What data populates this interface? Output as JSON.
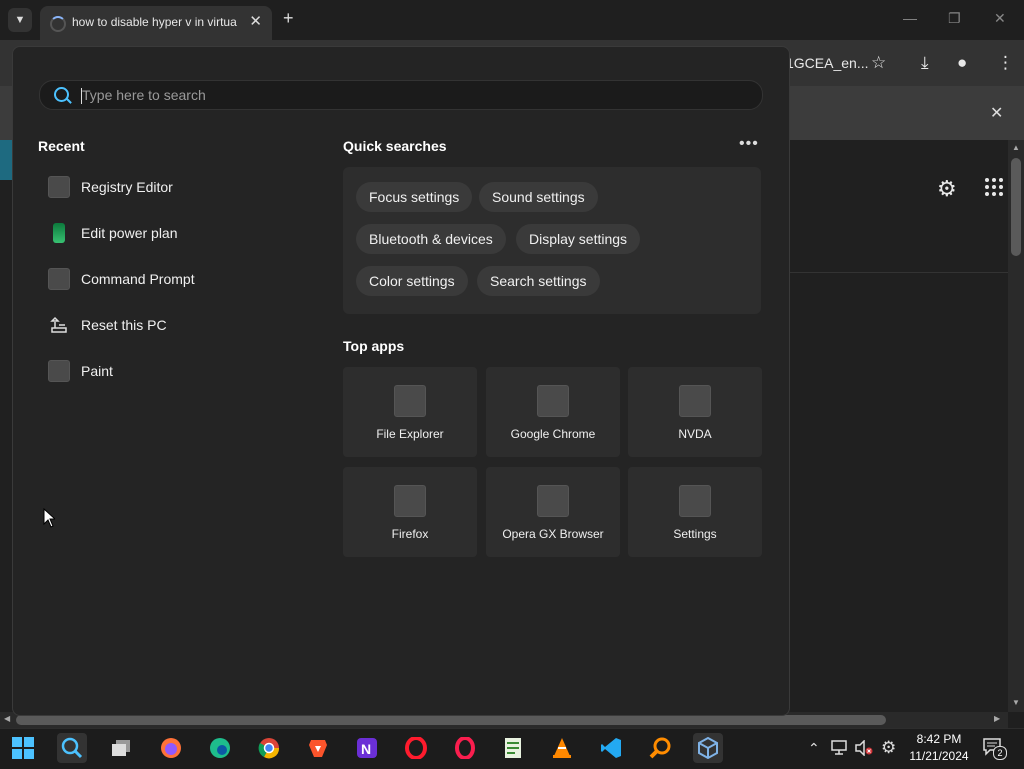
{
  "browser": {
    "tab_title": "how to disable hyper v in virtua",
    "url_tail": "1GCEA_en...",
    "tab_menu_icon": "chevron-down-icon"
  },
  "start_menu": {
    "search": {
      "placeholder": "Type here to search",
      "value": ""
    },
    "recent": {
      "title": "Recent",
      "items": [
        {
          "label": "Registry Editor",
          "icon": "app-placeholder-icon"
        },
        {
          "label": "Edit power plan",
          "icon": "battery-icon"
        },
        {
          "label": "Command Prompt",
          "icon": "app-placeholder-icon"
        },
        {
          "label": "Reset this PC",
          "icon": "reset-pc-icon"
        },
        {
          "label": "Paint",
          "icon": "app-placeholder-icon"
        }
      ]
    },
    "quick_searches": {
      "title": "Quick searches",
      "more_label": "•••",
      "chips": [
        "Focus settings",
        "Sound settings",
        "Bluetooth & devices",
        "Display settings",
        "Color settings",
        "Search settings"
      ]
    },
    "top_apps": {
      "title": "Top apps",
      "apps": [
        "File Explorer",
        "Google Chrome",
        "NVDA",
        "Firefox",
        "Opera GX Browser",
        "Settings"
      ]
    }
  },
  "taskbar": {
    "clock_time": "8:42 PM",
    "clock_date": "11/21/2024",
    "notification_count": "2",
    "apps": [
      "start",
      "search",
      "task-view",
      "firefox",
      "edge",
      "chrome",
      "brave",
      "notepad-plus",
      "opera",
      "opera-gx",
      "notepad",
      "vlc",
      "vscode",
      "search-everything",
      "virtualbox"
    ]
  },
  "colors": {
    "accent": "#4cc2ff",
    "menu_bg": "#242424",
    "tile_bg": "#2d2d2d",
    "chip_bg": "#3a3a3a"
  }
}
